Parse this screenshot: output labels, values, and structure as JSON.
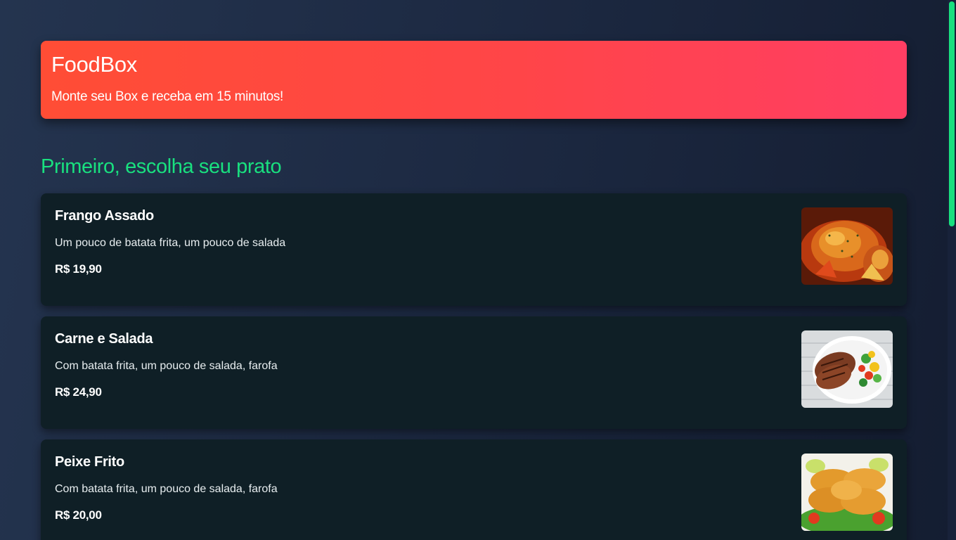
{
  "header": {
    "title": "FoodBox",
    "subtitle": "Monte seu Box e receba em 15 minutos!"
  },
  "section": {
    "title": "Primeiro, escolha seu prato"
  },
  "dishes": [
    {
      "name": "Frango Assado",
      "description": "Um pouco de batata frita, um pouco de salada",
      "price": "R$ 19,90",
      "image": "roast-chicken-photo"
    },
    {
      "name": "Carne e Salada",
      "description": "Com batata frita, um pouco de salada, farofa",
      "price": "R$ 24,90",
      "image": "steak-salad-photo"
    },
    {
      "name": "Peixe Frito",
      "description": "Com batata frita, um pouco de salada, farofa",
      "price": "R$ 20,00",
      "image": "fried-fish-photo"
    }
  ],
  "colors": {
    "accent": "#19e07f",
    "header_start": "#ff4d35",
    "header_end": "#ff3e63",
    "card_bg": "#0f1f26"
  }
}
